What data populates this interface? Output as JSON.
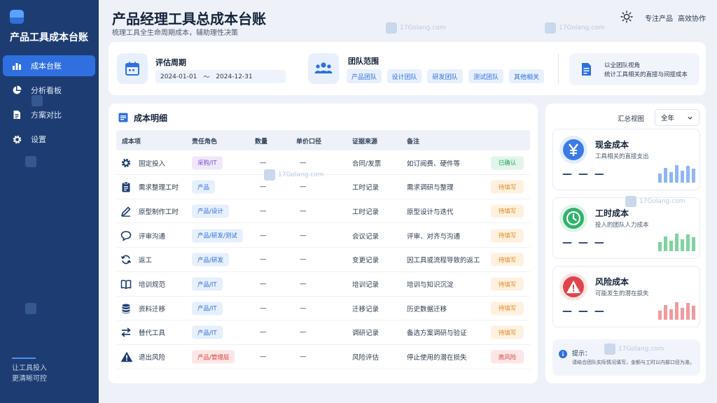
{
  "app": {
    "title": "产品工具成本台账"
  },
  "sidebar": {
    "items": [
      {
        "label": "成本台账",
        "icon": "bar-chart-icon",
        "active": true
      },
      {
        "label": "分析看板",
        "icon": "pie-chart-icon",
        "active": false
      },
      {
        "label": "方案对比",
        "icon": "document-icon",
        "active": false
      },
      {
        "label": "设置",
        "icon": "gear-icon",
        "active": false
      }
    ],
    "footer_line1": "让工具投入",
    "footer_line2": "更清晰可控"
  },
  "header": {
    "title": "产品经理工具总成本台账",
    "subtitle": "梳理工具全生命周期成本，辅助理性决策",
    "link1": "专注产品",
    "link2": "高效协作"
  },
  "filters": {
    "period_label": "评估周期",
    "date_start": "2024-01-01",
    "date_sep": "～",
    "date_end": "2024-12-31",
    "team_label": "团队范围",
    "teams": [
      "产品团队",
      "设计团队",
      "研发团队",
      "测试团队",
      "其他相关"
    ],
    "view_line1": "以全团队视角",
    "view_line2": "统计工具相关的直接与间接成本"
  },
  "table": {
    "title": "成本明细",
    "headers": {
      "item": "成本项",
      "role": "责任角色",
      "qty": "数量",
      "unit": "单价口径",
      "source": "证据来源",
      "note": "备注"
    },
    "rows": [
      {
        "item": "固定投入",
        "icon": "gear-icon",
        "role": "采购/IT",
        "role_color": "purple",
        "qty": "—",
        "unit": "—",
        "source": "合同/发票",
        "note": "如订阅费、硬件等",
        "status": "已确认",
        "status_color": "green"
      },
      {
        "item": "需求整理工时",
        "icon": "clipboard-icon",
        "role": "产品",
        "role_color": "blue",
        "qty": "—",
        "unit": "—",
        "source": "工时记录",
        "note": "需求调研与整理",
        "status": "待填写",
        "status_color": "orange"
      },
      {
        "item": "原型制作工时",
        "icon": "pen-icon",
        "role": "产品/设计",
        "role_color": "blue",
        "qty": "—",
        "unit": "—",
        "source": "工时记录",
        "note": "原型设计与迭代",
        "status": "待填写",
        "status_color": "orange"
      },
      {
        "item": "评审沟通",
        "icon": "chat-icon",
        "role": "产品/研发/测试",
        "role_color": "blue",
        "qty": "—",
        "unit": "—",
        "source": "会议记录",
        "note": "评审、对齐与沟通",
        "status": "待填写",
        "status_color": "orange"
      },
      {
        "item": "返工",
        "icon": "refresh-icon",
        "role": "产品/研发",
        "role_color": "blue",
        "qty": "—",
        "unit": "—",
        "source": "变更记录",
        "note": "因工具或流程导致的返工",
        "status": "待填写",
        "status_color": "orange"
      },
      {
        "item": "培训规范",
        "icon": "book-icon",
        "role": "产品/IT",
        "role_color": "blue",
        "qty": "—",
        "unit": "—",
        "source": "培训记录",
        "note": "培训与知识沉淀",
        "status": "待填写",
        "status_color": "orange"
      },
      {
        "item": "资料迁移",
        "icon": "database-icon",
        "role": "产品/IT",
        "role_color": "blue",
        "qty": "—",
        "unit": "—",
        "source": "迁移记录",
        "note": "历史数据迁移",
        "status": "待填写",
        "status_color": "orange"
      },
      {
        "item": "替代工具",
        "icon": "swap-icon",
        "role": "产品/IT",
        "role_color": "blue",
        "qty": "—",
        "unit": "—",
        "source": "调研记录",
        "note": "备选方案调研与验证",
        "status": "待填写",
        "status_color": "orange"
      },
      {
        "item": "退出风险",
        "icon": "warning-icon",
        "role": "产品/管理层",
        "role_color": "red",
        "qty": "—",
        "unit": "—",
        "source": "风险评估",
        "note": "停止使用的潜在损失",
        "status": "高风险",
        "status_color": "red"
      }
    ]
  },
  "summary": {
    "label": "汇总视图",
    "range": "全年",
    "cards": [
      {
        "title": "现金成本",
        "desc": "工具相关的直接支出",
        "value": "— — —",
        "icon": "yen-icon",
        "color": "#3b7be8",
        "bg": "#e3edfd",
        "bar_color": "#8fb6f2"
      },
      {
        "title": "工时成本",
        "desc": "投入的团队人力成本",
        "value": "— — —",
        "icon": "clock-icon",
        "color": "#2fb36a",
        "bg": "#dff5e8",
        "bar_color": "#7fd3a0"
      },
      {
        "title": "风险成本",
        "desc": "可能发生的潜在损失",
        "value": "— — —",
        "icon": "warning-icon",
        "color": "#e0454b",
        "bg": "#fde6e6",
        "bar_color": "#f19a9c"
      }
    ],
    "tip_title": "提示：",
    "tip_text": "请结合团队实际情况填写，金额与工时以内部口径为准。"
  },
  "watermark": "17Golang.com"
}
